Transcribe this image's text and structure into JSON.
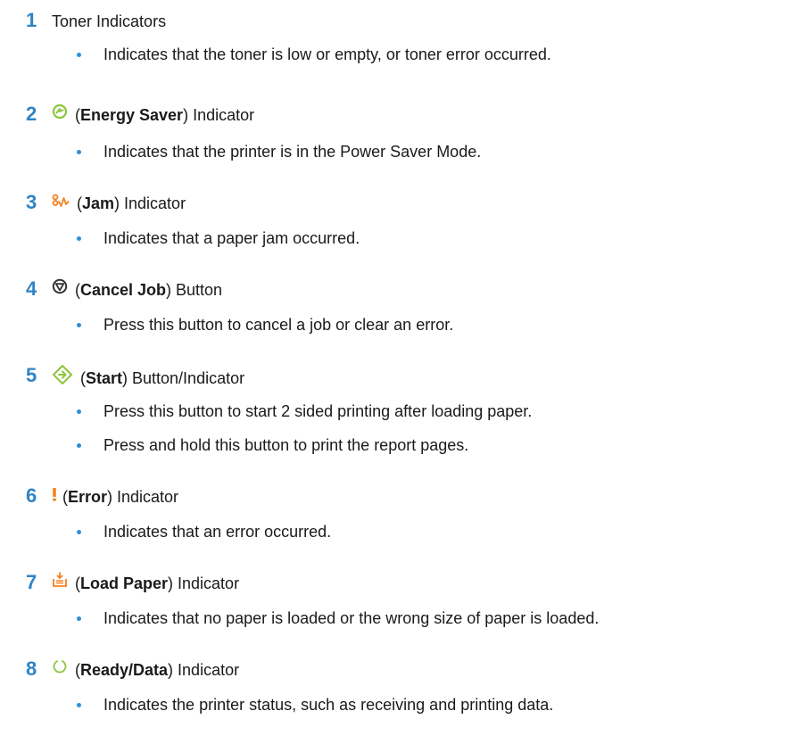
{
  "items": [
    {
      "number": "1",
      "title": "Toner Indicators",
      "bullets": [
        "Indicates that the toner is low or empty, or toner error occurred."
      ]
    },
    {
      "number": "2",
      "icon": "energy-saver-icon",
      "open": "(",
      "name": "Energy Saver",
      "close": ") Indicator",
      "bullets": [
        "Indicates that the printer is in the Power Saver Mode."
      ]
    },
    {
      "number": "3",
      "icon": "jam-icon",
      "open": "(",
      "name": "Jam",
      "close": ") Indicator",
      "bullets": [
        "Indicates that a paper jam occurred."
      ]
    },
    {
      "number": "4",
      "icon": "cancel-job-icon",
      "open": "(",
      "name": "Cancel Job",
      "close": ") Button",
      "bullets": [
        "Press this button to cancel a job or clear an error."
      ]
    },
    {
      "number": "5",
      "icon": "start-icon",
      "open": "(",
      "name": "Start",
      "close": ") Button/Indicator",
      "bullets": [
        "Press this button to start 2 sided printing after loading paper.",
        "Press and hold this button to print the report pages."
      ]
    },
    {
      "number": "6",
      "icon": "error-icon",
      "open": "(",
      "name": "Error",
      "close": ") Indicator",
      "bullets": [
        "Indicates that an error occurred."
      ]
    },
    {
      "number": "7",
      "icon": "load-paper-icon",
      "open": "(",
      "name": "Load Paper",
      "close": ") Indicator",
      "bullets": [
        "Indicates that no paper is loaded or the wrong size of paper is loaded."
      ]
    },
    {
      "number": "8",
      "icon": "ready-data-icon",
      "open": "(",
      "name": "Ready/Data",
      "close": ") Indicator",
      "bullets": [
        "Indicates the printer status, such as receiving and printing data."
      ]
    }
  ],
  "colors": {
    "number": "#2f84c6",
    "bullet": "#2f8fd6",
    "energy_saver": "#8cc63f",
    "jam": "#f5821f",
    "start": "#8cc63f",
    "error": "#f5821f",
    "load_paper": "#f5821f",
    "ready_data": "#8cc63f"
  }
}
